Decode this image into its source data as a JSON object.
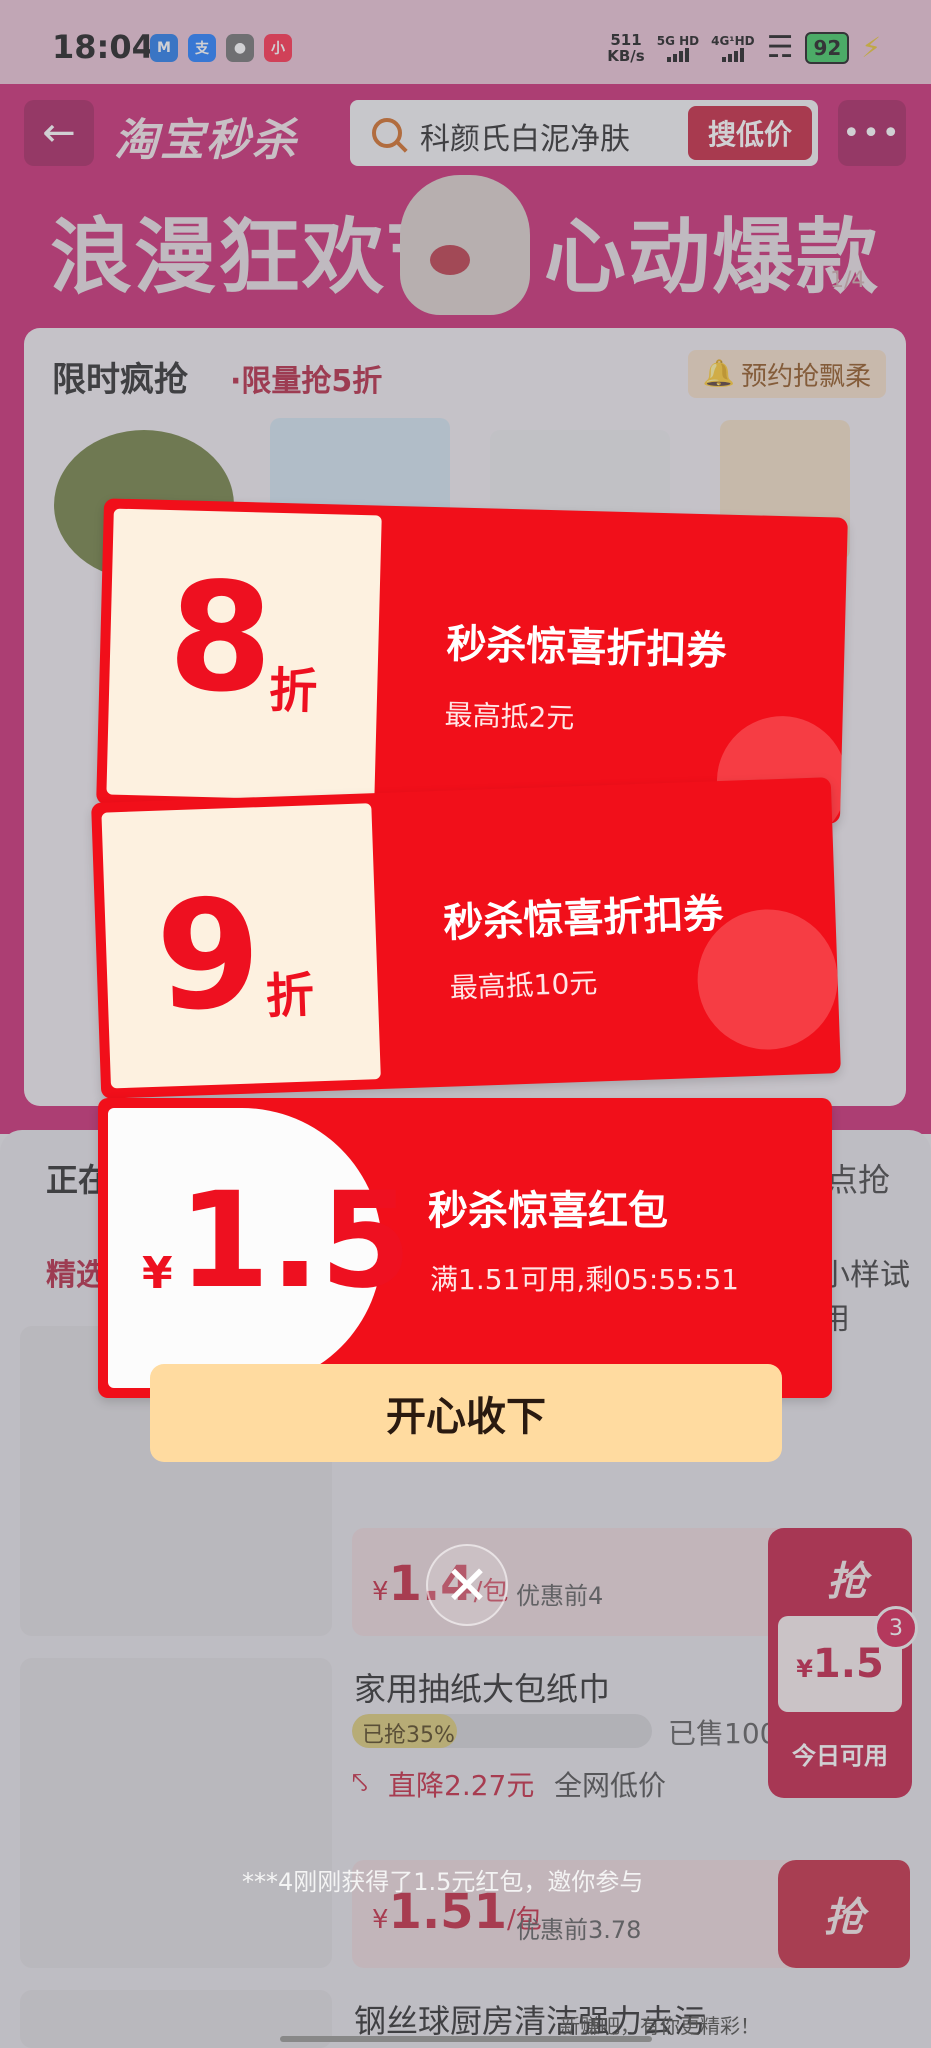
{
  "status_bar": {
    "time": "18:04",
    "apps": [
      {
        "icon": "meituan-app-icon",
        "glyph": "M",
        "color": "#1a73e8"
      },
      {
        "icon": "alipay-app-icon",
        "glyph": "支",
        "color": "#1677ff"
      },
      {
        "icon": "wechat-app-icon",
        "glyph": "●",
        "color": "#6a6a6a"
      },
      {
        "icon": "xiaohongshu-app-icon",
        "glyph": "小",
        "color": "#ff2442"
      }
    ],
    "net_speed_value": "511",
    "net_speed_unit": "KB/s",
    "signal_1": "5G HD",
    "signal_2": "4G¹HD",
    "battery": "92"
  },
  "header": {
    "logo": "淘宝秒杀",
    "search_query": "科颜氏白泥净肤",
    "search_button": "搜低价",
    "banner_left": "浪漫狂欢节",
    "banner_right": "心动爆款",
    "banner_pager": "1/4"
  },
  "limited": {
    "title": "限时疯抢",
    "subtitle": "·限量抢5折",
    "reserve_label": "预约抢飘柔"
  },
  "coupons": [
    {
      "value": "8",
      "unit": "折",
      "title": "秒杀惊喜折扣券",
      "subtitle": "最高抵2元"
    },
    {
      "value": "9",
      "unit": "折",
      "title": "秒杀惊喜折扣券",
      "subtitle": "最高抵10元"
    },
    {
      "currency": "¥",
      "value": "1.5",
      "title": "秒杀惊喜红包",
      "subtitle": "满1.51可用,剩05:55:51"
    }
  ],
  "accept_button": "开心收下",
  "list": {
    "tab_now": "正在",
    "tab_pre": "点抢",
    "category_left": "精选",
    "category_right": "小样试用",
    "items": [
      {
        "price_currency": "¥",
        "price": "1.4",
        "unit": "/包",
        "before": "优惠前4",
        "grab": "抢"
      },
      {
        "title": "家用抽纸大包纸巾",
        "progress_label": "已抢35%",
        "progress": 0.35,
        "sold": "已售100",
        "drop": "直降2.27元",
        "lowest": "全网低价",
        "price_currency": "¥",
        "price": "1.51",
        "unit": "/包",
        "before": "优惠前3.78",
        "grab": "抢"
      },
      {
        "title": "钢丝球厨房清洁强力去污"
      }
    ]
  },
  "float_widget": {
    "grab": "抢",
    "currency": "¥",
    "value": "1.5",
    "label": "今日可用",
    "badge": "3"
  },
  "toast": "***4刚刚获得了1.5元红包，邀你参与",
  "watermark": "新赚吧，有你更精彩！"
}
